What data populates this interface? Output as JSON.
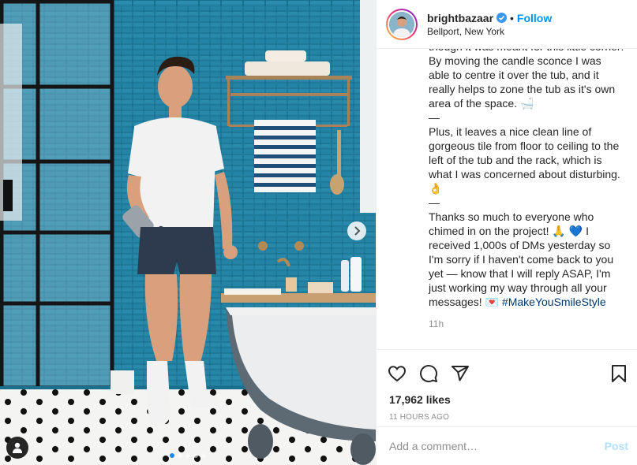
{
  "post": {
    "username": "brightbazaar",
    "verified": true,
    "separator": "•",
    "follow_label": "Follow",
    "location": "Bellport, New York"
  },
  "caption": {
    "line_partial": "though it was meant for this little corner! By moving the candle sconce I was able to centre it over the tub, and it really helps to zone the tub as it's own area of the space. 🛁",
    "divider1": "—",
    "para2": "Plus, it leaves a nice clean line of gorgeous tile from floor to ceiling to the left of the tub and the rack, which is what I was concerned about disturbing. 👌",
    "divider2": "—",
    "para3": "Thanks so much to everyone who chimed in on the project! 🙏 💙 I received 1,000s of DMs yesterday so I'm sorry if I haven't come back to you yet — know that I will reply ASAP, I'm just working my way through all your messages! 💌",
    "hashtag": "#MakeYouSmileStyle",
    "time": "11h"
  },
  "actions": {
    "like_icon": "heart-icon",
    "comment_icon": "comment-icon",
    "share_icon": "share-icon",
    "save_icon": "bookmark-icon"
  },
  "likes": "17,962 likes",
  "post_time": "11 HOURS AGO",
  "comment": {
    "placeholder": "Add a comment…",
    "post_label": "Post"
  },
  "carousel": {
    "slide_count": 5,
    "active_index": 0
  },
  "colors": {
    "follow": "#0095f6",
    "hashtag": "#00376b",
    "tile": "#1d7897"
  }
}
